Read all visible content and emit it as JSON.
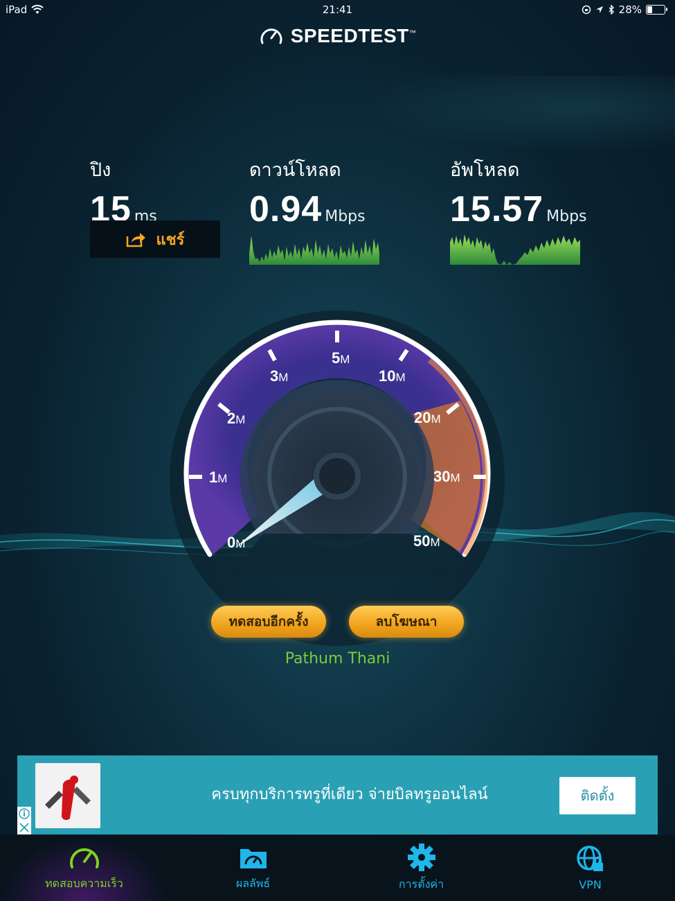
{
  "status_bar": {
    "device": "iPad",
    "time": "21:41",
    "battery_pct": "28%"
  },
  "app": {
    "logo_text": "SPEEDTEST",
    "trademark": "™"
  },
  "stats": {
    "ping": {
      "label": "ปิง",
      "value": "15",
      "unit": "ms"
    },
    "download": {
      "label": "ดาวน์โหลด",
      "value": "0.94",
      "unit": "Mbps"
    },
    "upload": {
      "label": "อัพโหลด",
      "value": "15.57",
      "unit": "Mbps"
    }
  },
  "share": {
    "label": "แชร์"
  },
  "gauge": {
    "ticks": [
      {
        "num": "0",
        "unit": "M"
      },
      {
        "num": "1",
        "unit": "M"
      },
      {
        "num": "2",
        "unit": "M"
      },
      {
        "num": "3",
        "unit": "M"
      },
      {
        "num": "5",
        "unit": "M"
      },
      {
        "num": "10",
        "unit": "M"
      },
      {
        "num": "20",
        "unit": "M"
      },
      {
        "num": "30",
        "unit": "M"
      },
      {
        "num": "50",
        "unit": "M"
      }
    ]
  },
  "actions": {
    "retest_label": "ทดสอบอีกครั้ง",
    "remove_ads_label": "ลบโฆษณา"
  },
  "location": "Pathum Thani",
  "ad": {
    "text": "ครบทุกบริการทรูที่เดียว จ่ายบิลทรูออนไลน์",
    "install_label": "ติดตั้ง"
  },
  "tabs": [
    {
      "label": "ทดสอบความเร็ว",
      "icon": "speedometer-icon",
      "active": true,
      "color": "#7ed321"
    },
    {
      "label": "ผลลัพธ์",
      "icon": "results-folder-icon",
      "active": false,
      "color": "#1fb6ea"
    },
    {
      "label": "การตั้งค่า",
      "icon": "gear-icon",
      "active": false,
      "color": "#1fb6ea"
    },
    {
      "label": "VPN",
      "icon": "vpn-globe-icon",
      "active": false,
      "color": "#1fb6ea"
    }
  ],
  "colors": {
    "accent_orange": "#f5a623",
    "green": "#7ccc3a",
    "blue": "#1fb6ea",
    "ad_bg": "#2aa0b4"
  }
}
